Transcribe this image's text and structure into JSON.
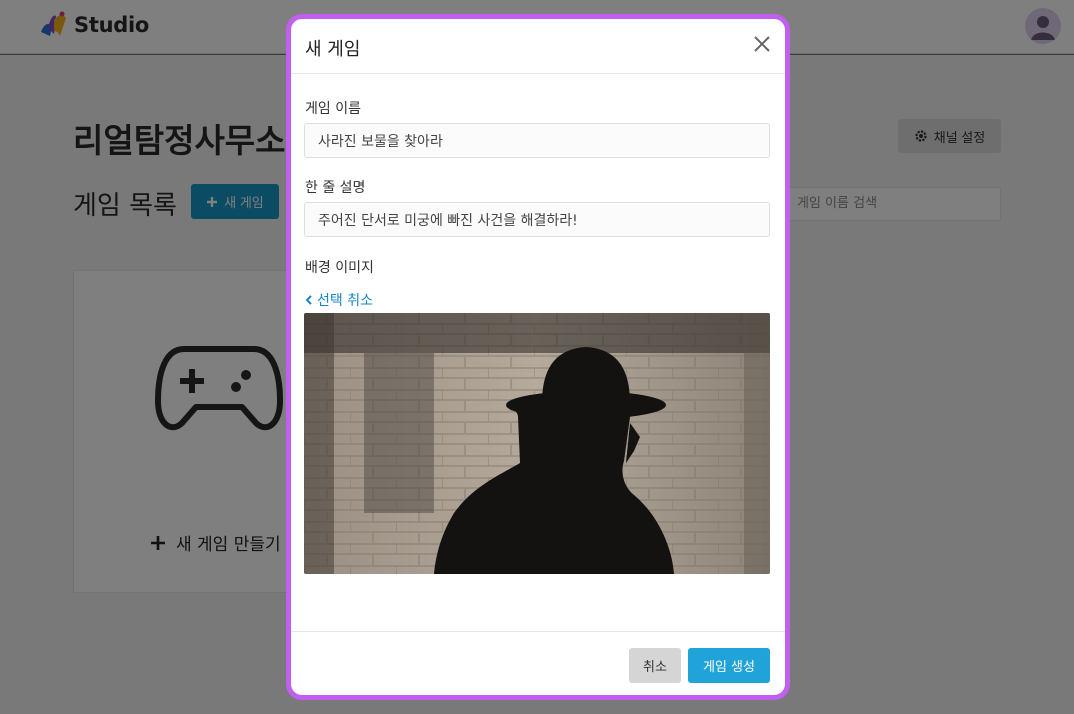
{
  "app": {
    "logo_text": "Studio"
  },
  "page": {
    "channel_title": "리얼탐정사무소",
    "channel_settings_label": "채널 설정",
    "list_title": "게임 목록",
    "new_game_label": "새 게임",
    "search_placeholder": "게임 이름 검색",
    "create_card_label": "새 게임 만들기"
  },
  "modal": {
    "title": "새 게임",
    "name_label": "게임 이름",
    "name_value": "사라진 보물을 찾아라",
    "desc_label": "한 줄 설명",
    "desc_value": "주어진 단서로 미궁에 빠진 사건을 해결하라!",
    "bg_label": "배경 이미지",
    "deselect_label": "선택 취소",
    "cancel_label": "취소",
    "create_label": "게임 생성"
  },
  "colors": {
    "accent": "#1fa3d9",
    "modal_border": "#c15ff0",
    "link": "#1a86c7"
  },
  "icons": [
    "logo-mark-icon",
    "avatar-icon",
    "gear-icon",
    "plus-icon",
    "search-icon",
    "gamepad-icon",
    "close-icon",
    "chevron-left-icon"
  ]
}
